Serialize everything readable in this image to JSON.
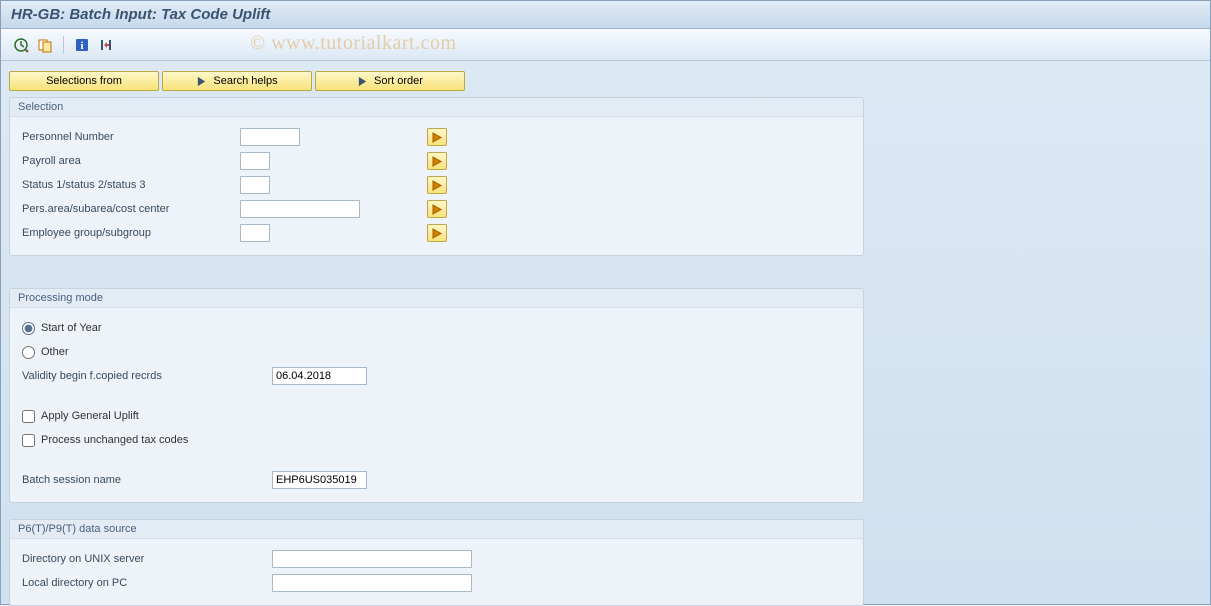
{
  "header": {
    "title": "HR-GB: Batch Input: Tax Code Uplift"
  },
  "watermark": "© www.tutorialkart.com",
  "toolbar": {
    "icons": [
      "clock-check-icon",
      "order-icon",
      "info-icon",
      "collapse-icon"
    ]
  },
  "buttons": {
    "selections_from": "Selections from",
    "search_helps": "Search helps",
    "sort_order": "Sort order"
  },
  "groups": {
    "selection": {
      "title": "Selection",
      "fields": {
        "personnel_number": {
          "label": "Personnel Number",
          "value": ""
        },
        "payroll_area": {
          "label": "Payroll area",
          "value": ""
        },
        "status": {
          "label": "Status 1/status 2/status 3",
          "value": ""
        },
        "pers_area": {
          "label": "Pers.area/subarea/cost center",
          "value": ""
        },
        "emp_group": {
          "label": "Employee group/subgroup",
          "value": ""
        }
      }
    },
    "processing": {
      "title": "Processing mode",
      "radio_start": "Start of Year",
      "radio_other": "Other",
      "validity_label": "Validity begin f.copied recrds",
      "validity_value": "06.04.2018",
      "apply_uplift": "Apply General Uplift",
      "process_unchanged": "Process unchanged tax codes",
      "batch_label": "Batch session name",
      "batch_value": "EHP6US035019"
    },
    "datasource": {
      "title": "P6(T)/P9(T) data source",
      "dir_unix": {
        "label": "Directory on UNIX server",
        "value": ""
      },
      "dir_pc": {
        "label": "Local directory on PC",
        "value": ""
      }
    }
  }
}
